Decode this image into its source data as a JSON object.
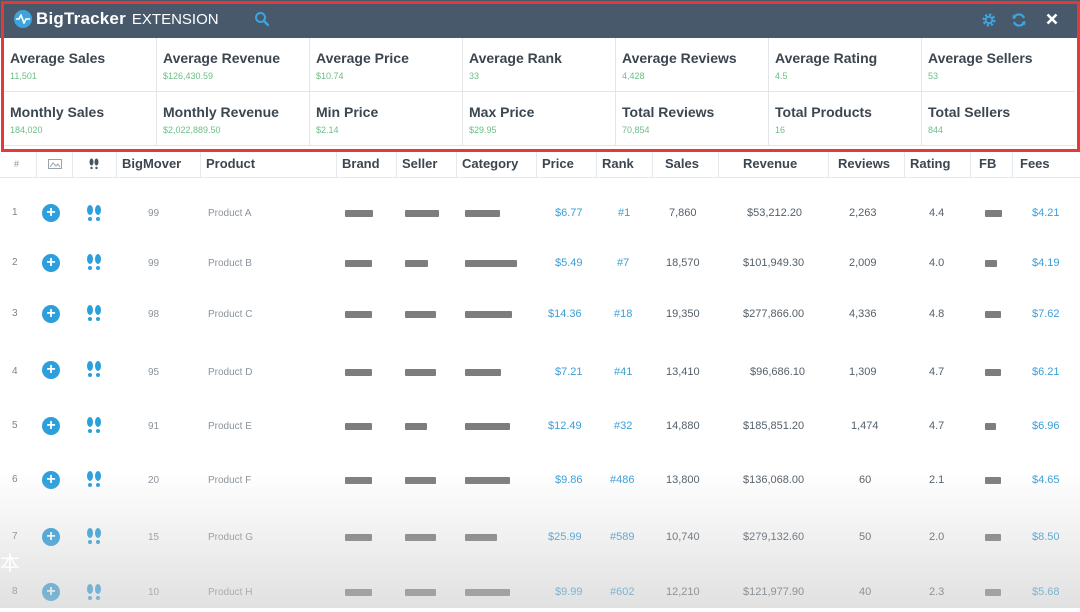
{
  "header": {
    "brand_bold": "BigTracker",
    "brand_light": "EXTENSION",
    "colors": {
      "bar": "#47596b",
      "accent": "#3fa3dd",
      "highlight": "#e23a3a"
    },
    "icons": [
      "pulse-logo-icon",
      "search-icon",
      "gear-icon",
      "refresh-icon",
      "close-icon"
    ]
  },
  "summary": [
    {
      "label": "Average Sales",
      "value": "11,501"
    },
    {
      "label": "Average Revenue",
      "value": "$126,430.59"
    },
    {
      "label": "Average Price",
      "value": "$10.74"
    },
    {
      "label": "Average Rank",
      "value": "33"
    },
    {
      "label": "Average Reviews",
      "value": "4,428"
    },
    {
      "label": "Average Rating",
      "value": "4.5"
    },
    {
      "label": "Average Sellers",
      "value": "53"
    },
    {
      "label": "Monthly Sales",
      "value": "184,020"
    },
    {
      "label": "Monthly Revenue",
      "value": "$2,022,889.50"
    },
    {
      "label": "Min Price",
      "value": "$2.14"
    },
    {
      "label": "Max Price",
      "value": "$29.95"
    },
    {
      "label": "Total Reviews",
      "value": "70,854"
    },
    {
      "label": "Total Products",
      "value": "16"
    },
    {
      "label": "Total Sellers",
      "value": "844"
    }
  ],
  "columns": {
    "index": "#",
    "bigmover": "BigMover",
    "product": "Product",
    "brand": "Brand",
    "seller": "Seller",
    "category": "Category",
    "price": "Price",
    "rank": "Rank",
    "sales": "Sales",
    "revenue": "Revenue",
    "reviews": "Reviews",
    "rating": "Rating",
    "fb": "FB",
    "fees": "Fees"
  },
  "rows": [
    {
      "index": "1",
      "bigmover": "99",
      "product": "Product A",
      "price": "$6.77",
      "rank": "#1",
      "sales": "7,860",
      "revenue": "$53,212.20",
      "reviews": "2,263",
      "rating": "4.4",
      "fees": "$4.21"
    },
    {
      "index": "2",
      "bigmover": "99",
      "product": "Product B",
      "price": "$5.49",
      "rank": "#7",
      "sales": "18,570",
      "revenue": "$101,949.30",
      "reviews": "2,009",
      "rating": "4.0",
      "fees": "$4.19"
    },
    {
      "index": "3",
      "bigmover": "98",
      "product": "Product C",
      "price": "$14.36",
      "rank": "#18",
      "sales": "19,350",
      "revenue": "$277,866.00",
      "reviews": "4,336",
      "rating": "4.8",
      "fees": "$7.62"
    },
    {
      "index": "4",
      "bigmover": "95",
      "product": "Product D",
      "price": "$7.21",
      "rank": "#41",
      "sales": "13,410",
      "revenue": "$96,686.10",
      "reviews": "1,309",
      "rating": "4.7",
      "fees": "$6.21"
    },
    {
      "index": "5",
      "bigmover": "91",
      "product": "Product E",
      "price": "$12.49",
      "rank": "#32",
      "sales": "14,880",
      "revenue": "$185,851.20",
      "reviews": "1,474",
      "rating": "4.7",
      "fees": "$6.96"
    },
    {
      "index": "6",
      "bigmover": "20",
      "product": "Product F",
      "price": "$9.86",
      "rank": "#486",
      "sales": "13,800",
      "revenue": "$136,068.00",
      "reviews": "60",
      "rating": "2.1",
      "fees": "$4.65"
    },
    {
      "index": "7",
      "bigmover": "15",
      "product": "Product G",
      "price": "$25.99",
      "rank": "#589",
      "sales": "10,740",
      "revenue": "$279,132.60",
      "reviews": "50",
      "rating": "2.0",
      "fees": "$8.50"
    },
    {
      "index": "8",
      "bigmover": "10",
      "product": "Product H",
      "price": "$9.99",
      "rank": "#602",
      "sales": "12,210",
      "revenue": "$121,977.90",
      "reviews": "40",
      "rating": "2.3",
      "fees": "$5.68"
    }
  ],
  "watermark": "本"
}
